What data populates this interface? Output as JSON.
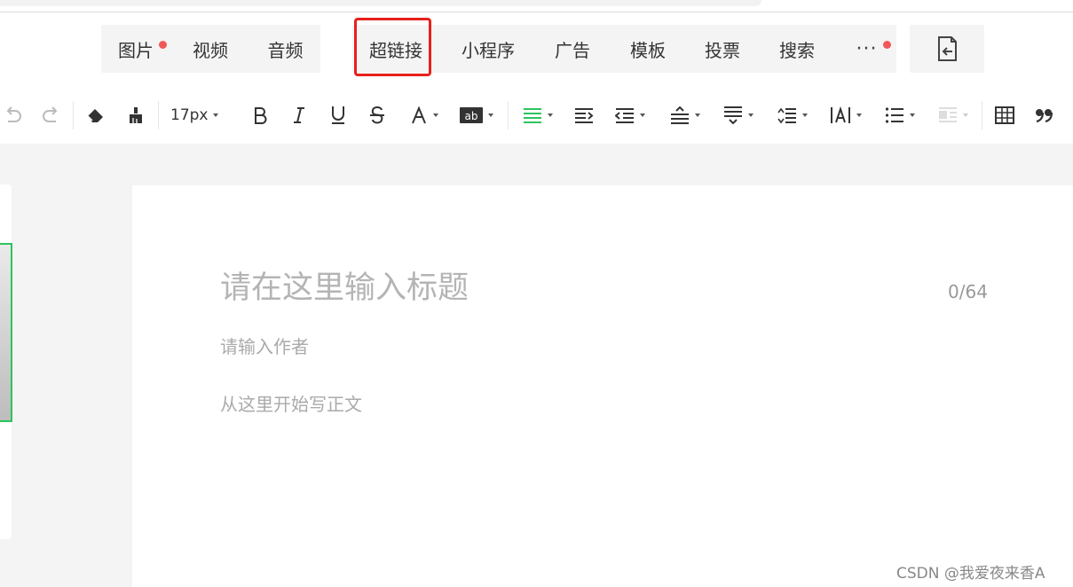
{
  "insert_toolbar": {
    "group1": [
      {
        "label": "图片",
        "badge": true
      },
      {
        "label": "视频",
        "badge": false
      },
      {
        "label": "音频",
        "badge": false
      }
    ],
    "group2": [
      {
        "label": "超链接",
        "badge": false,
        "highlighted": true
      },
      {
        "label": "小程序",
        "badge": false
      },
      {
        "label": "广告",
        "badge": false
      },
      {
        "label": "模板",
        "badge": false
      },
      {
        "label": "投票",
        "badge": false
      },
      {
        "label": "搜索",
        "badge": false
      },
      {
        "label": "···",
        "badge": true
      }
    ],
    "highlight_color": "#e8201c",
    "badge_color": "#f25858"
  },
  "format_toolbar": {
    "font_size": "17px",
    "accent_color": "#2dc35f",
    "icons": [
      "undo-icon",
      "redo-icon",
      "eraser-icon",
      "format-brush-icon",
      "bold-icon",
      "italic-icon",
      "underline-icon",
      "strikethrough-icon",
      "font-color-icon",
      "background-color-icon",
      "align-justify-icon",
      "indent-icon",
      "outdent-icon",
      "paragraph-spacing-before-icon",
      "paragraph-spacing-after-icon",
      "line-height-icon",
      "letter-spacing-icon",
      "bulleted-list-icon",
      "image-float-icon",
      "table-icon",
      "blockquote-icon"
    ]
  },
  "editor": {
    "title_placeholder": "请在这里输入标题",
    "title_counter": "0/64",
    "author_placeholder": "请输入作者",
    "body_placeholder": "从这里开始写正文"
  },
  "watermark": "CSDN @我爱夜来香A"
}
